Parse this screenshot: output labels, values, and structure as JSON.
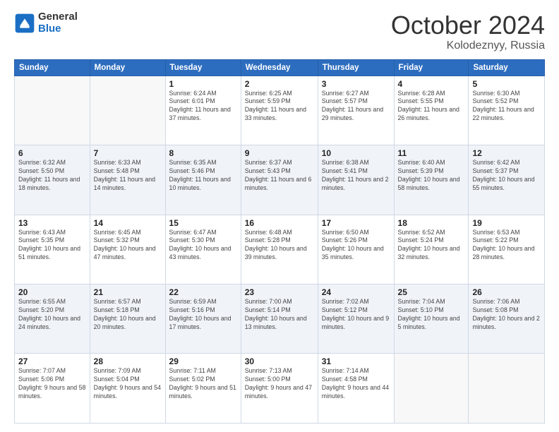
{
  "logo": {
    "general": "General",
    "blue": "Blue"
  },
  "title": "October 2024",
  "subtitle": "Kolodeznyy, Russia",
  "days_header": [
    "Sunday",
    "Monday",
    "Tuesday",
    "Wednesday",
    "Thursday",
    "Friday",
    "Saturday"
  ],
  "weeks": [
    [
      {
        "day": "",
        "info": ""
      },
      {
        "day": "",
        "info": ""
      },
      {
        "day": "1",
        "info": "Sunrise: 6:24 AM\nSunset: 6:01 PM\nDaylight: 11 hours and 37 minutes."
      },
      {
        "day": "2",
        "info": "Sunrise: 6:25 AM\nSunset: 5:59 PM\nDaylight: 11 hours and 33 minutes."
      },
      {
        "day": "3",
        "info": "Sunrise: 6:27 AM\nSunset: 5:57 PM\nDaylight: 11 hours and 29 minutes."
      },
      {
        "day": "4",
        "info": "Sunrise: 6:28 AM\nSunset: 5:55 PM\nDaylight: 11 hours and 26 minutes."
      },
      {
        "day": "5",
        "info": "Sunrise: 6:30 AM\nSunset: 5:52 PM\nDaylight: 11 hours and 22 minutes."
      }
    ],
    [
      {
        "day": "6",
        "info": "Sunrise: 6:32 AM\nSunset: 5:50 PM\nDaylight: 11 hours and 18 minutes."
      },
      {
        "day": "7",
        "info": "Sunrise: 6:33 AM\nSunset: 5:48 PM\nDaylight: 11 hours and 14 minutes."
      },
      {
        "day": "8",
        "info": "Sunrise: 6:35 AM\nSunset: 5:46 PM\nDaylight: 11 hours and 10 minutes."
      },
      {
        "day": "9",
        "info": "Sunrise: 6:37 AM\nSunset: 5:43 PM\nDaylight: 11 hours and 6 minutes."
      },
      {
        "day": "10",
        "info": "Sunrise: 6:38 AM\nSunset: 5:41 PM\nDaylight: 11 hours and 2 minutes."
      },
      {
        "day": "11",
        "info": "Sunrise: 6:40 AM\nSunset: 5:39 PM\nDaylight: 10 hours and 58 minutes."
      },
      {
        "day": "12",
        "info": "Sunrise: 6:42 AM\nSunset: 5:37 PM\nDaylight: 10 hours and 55 minutes."
      }
    ],
    [
      {
        "day": "13",
        "info": "Sunrise: 6:43 AM\nSunset: 5:35 PM\nDaylight: 10 hours and 51 minutes."
      },
      {
        "day": "14",
        "info": "Sunrise: 6:45 AM\nSunset: 5:32 PM\nDaylight: 10 hours and 47 minutes."
      },
      {
        "day": "15",
        "info": "Sunrise: 6:47 AM\nSunset: 5:30 PM\nDaylight: 10 hours and 43 minutes."
      },
      {
        "day": "16",
        "info": "Sunrise: 6:48 AM\nSunset: 5:28 PM\nDaylight: 10 hours and 39 minutes."
      },
      {
        "day": "17",
        "info": "Sunrise: 6:50 AM\nSunset: 5:26 PM\nDaylight: 10 hours and 35 minutes."
      },
      {
        "day": "18",
        "info": "Sunrise: 6:52 AM\nSunset: 5:24 PM\nDaylight: 10 hours and 32 minutes."
      },
      {
        "day": "19",
        "info": "Sunrise: 6:53 AM\nSunset: 5:22 PM\nDaylight: 10 hours and 28 minutes."
      }
    ],
    [
      {
        "day": "20",
        "info": "Sunrise: 6:55 AM\nSunset: 5:20 PM\nDaylight: 10 hours and 24 minutes."
      },
      {
        "day": "21",
        "info": "Sunrise: 6:57 AM\nSunset: 5:18 PM\nDaylight: 10 hours and 20 minutes."
      },
      {
        "day": "22",
        "info": "Sunrise: 6:59 AM\nSunset: 5:16 PM\nDaylight: 10 hours and 17 minutes."
      },
      {
        "day": "23",
        "info": "Sunrise: 7:00 AM\nSunset: 5:14 PM\nDaylight: 10 hours and 13 minutes."
      },
      {
        "day": "24",
        "info": "Sunrise: 7:02 AM\nSunset: 5:12 PM\nDaylight: 10 hours and 9 minutes."
      },
      {
        "day": "25",
        "info": "Sunrise: 7:04 AM\nSunset: 5:10 PM\nDaylight: 10 hours and 5 minutes."
      },
      {
        "day": "26",
        "info": "Sunrise: 7:06 AM\nSunset: 5:08 PM\nDaylight: 10 hours and 2 minutes."
      }
    ],
    [
      {
        "day": "27",
        "info": "Sunrise: 7:07 AM\nSunset: 5:06 PM\nDaylight: 9 hours and 58 minutes."
      },
      {
        "day": "28",
        "info": "Sunrise: 7:09 AM\nSunset: 5:04 PM\nDaylight: 9 hours and 54 minutes."
      },
      {
        "day": "29",
        "info": "Sunrise: 7:11 AM\nSunset: 5:02 PM\nDaylight: 9 hours and 51 minutes."
      },
      {
        "day": "30",
        "info": "Sunrise: 7:13 AM\nSunset: 5:00 PM\nDaylight: 9 hours and 47 minutes."
      },
      {
        "day": "31",
        "info": "Sunrise: 7:14 AM\nSunset: 4:58 PM\nDaylight: 9 hours and 44 minutes."
      },
      {
        "day": "",
        "info": ""
      },
      {
        "day": "",
        "info": ""
      }
    ]
  ]
}
